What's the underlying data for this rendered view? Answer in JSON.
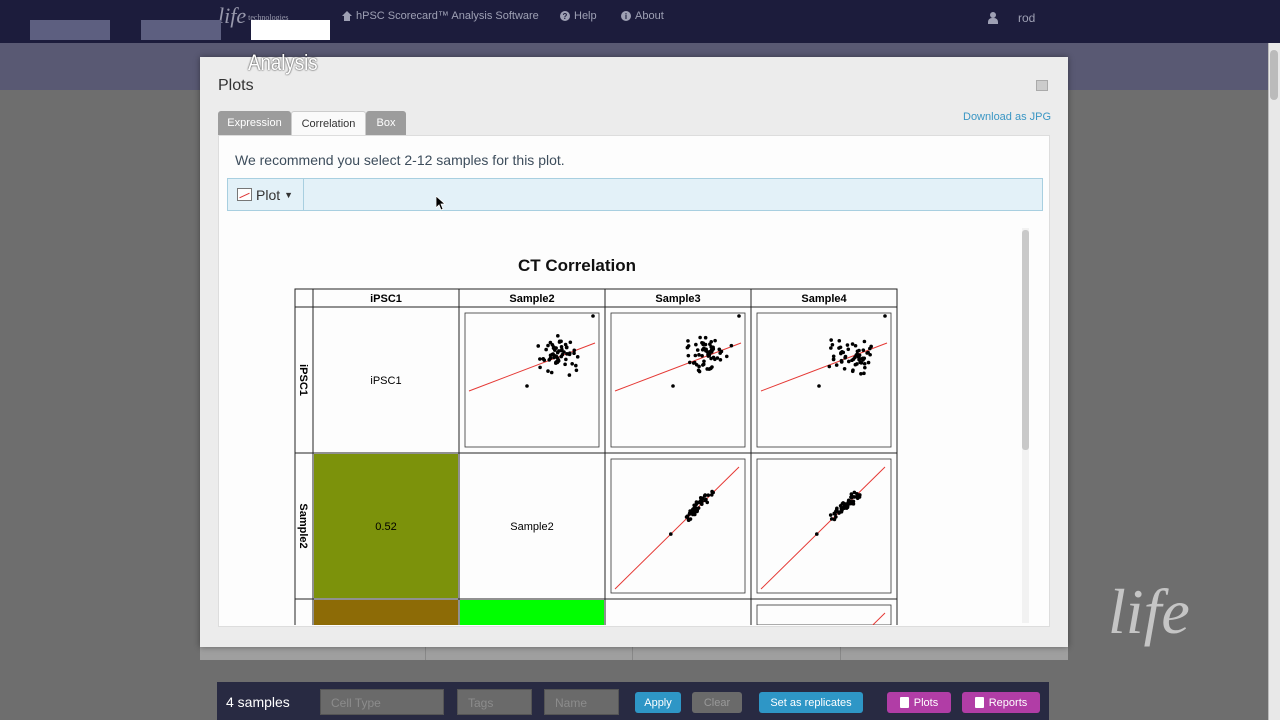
{
  "topbar": {
    "logo": "life",
    "logo_suffix": "technologies",
    "app_name": "hPSC Scorecard™ Analysis Software",
    "help": "Help",
    "about": "About",
    "username": "rod"
  },
  "overlay": {
    "analysis_label": "Analysis"
  },
  "modal": {
    "title": "Plots",
    "tabs": [
      {
        "label": "Expression"
      },
      {
        "label": "Correlation"
      },
      {
        "label": "Box"
      }
    ],
    "active_tab": "Correlation",
    "download": "Download as JPG",
    "recommend": "We recommend you select 2-12 samples for this plot.",
    "plot_button": "Plot"
  },
  "chart_data": {
    "type": "heatmap",
    "title": "CT Correlation",
    "columns": [
      "iPSC1",
      "Sample2",
      "Sample3",
      "Sample4"
    ],
    "rows": [
      "iPSC1",
      "Sample2"
    ],
    "diagonal_labels": [
      "iPSC1",
      "Sample2"
    ],
    "lower_triangle": [
      {
        "row": "Sample2",
        "col": "iPSC1",
        "value": 0.52,
        "color": "#7c920b"
      }
    ],
    "partial_row_colors": [
      "#8d6b06",
      "#00ff00"
    ],
    "regression_color": "#e53935"
  },
  "bottombar": {
    "count": "4 samples",
    "cell_type_placeholder": "Cell Type",
    "tags_placeholder": "Tags",
    "name_placeholder": "Name",
    "apply": "Apply",
    "clear": "Clear",
    "set_replicates": "Set as replicates",
    "plots": "Plots",
    "reports": "Reports"
  },
  "watermark": "life",
  "colors": {
    "topbar": "#1c1c3c",
    "link": "#3a96c4",
    "plots_button": "#b13da6",
    "apply_button": "#2e96c6"
  }
}
